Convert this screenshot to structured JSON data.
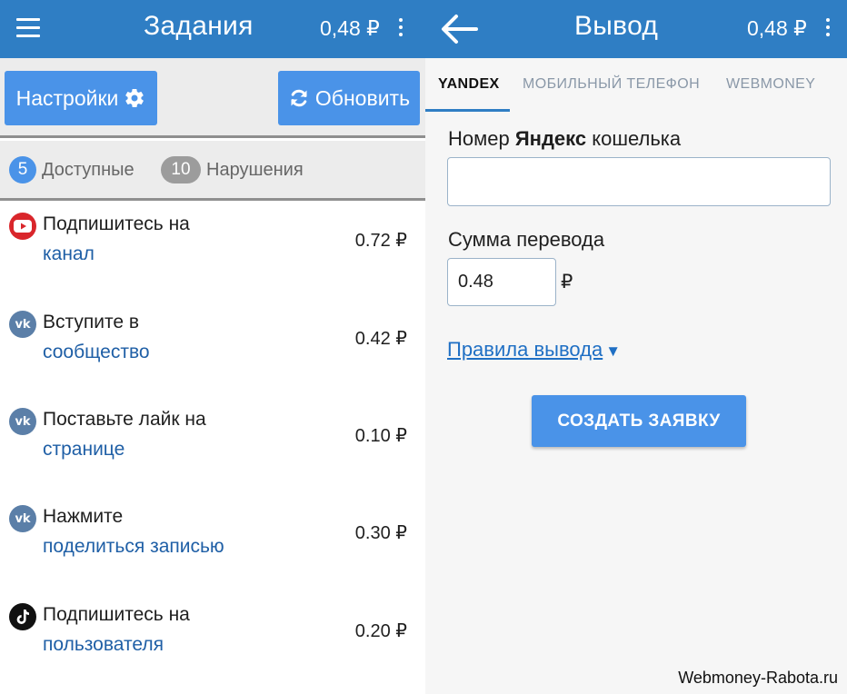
{
  "left": {
    "appbar": {
      "title": "Задания",
      "balance": "0,48 ₽"
    },
    "buttons": {
      "settings_label": "Настройки",
      "refresh_label": "Обновить"
    },
    "filters": {
      "available": {
        "count": "5",
        "label": "Доступные"
      },
      "violations": {
        "count": "10",
        "label": "Нарушения"
      }
    },
    "tasks": [
      {
        "icon": "youtube-icon",
        "action": "Подпишитесь на",
        "target": "канал",
        "price": "0.72 ₽"
      },
      {
        "icon": "vk-icon",
        "action": "Вступите в",
        "target": "сообщество",
        "price": "0.42 ₽"
      },
      {
        "icon": "vk-icon",
        "action": "Поставьте лайк на",
        "target": "странице",
        "price": "0.10 ₽"
      },
      {
        "icon": "vk-icon",
        "action": "Нажмите",
        "target": "поделиться записью",
        "price": "0.30 ₽"
      },
      {
        "icon": "tiktok-icon",
        "action": "Подпишитесь на",
        "target": "пользователя",
        "price": "0.20 ₽"
      }
    ],
    "vk_glyph": "vk"
  },
  "right": {
    "appbar": {
      "title": "Вывод",
      "balance": "0,48 ₽"
    },
    "tabs": [
      "YANDEX",
      "МОБИЛЬНЫЙ ТЕЛЕФОН",
      "WEBMONEY"
    ],
    "wallet_label": {
      "prefix": "Номер ",
      "bold": "Яндекс",
      "suffix": " кошелька"
    },
    "wallet_value": "",
    "amount_label": "Сумма перевода",
    "amount_value": "0.48",
    "currency": "₽",
    "rules_link": "Правила вывода",
    "rules_arrow": "▼",
    "submit_label": "СОЗДАТЬ ЗАЯВКУ"
  },
  "watermark": "Webmoney-Rabota.ru",
  "colors": {
    "appbar": "#2f7ec4",
    "button": "#4a93e8",
    "link": "#1f5fa6",
    "youtube": "#d9262b",
    "vk": "#5b7fa8",
    "tiktok": "#111111"
  }
}
